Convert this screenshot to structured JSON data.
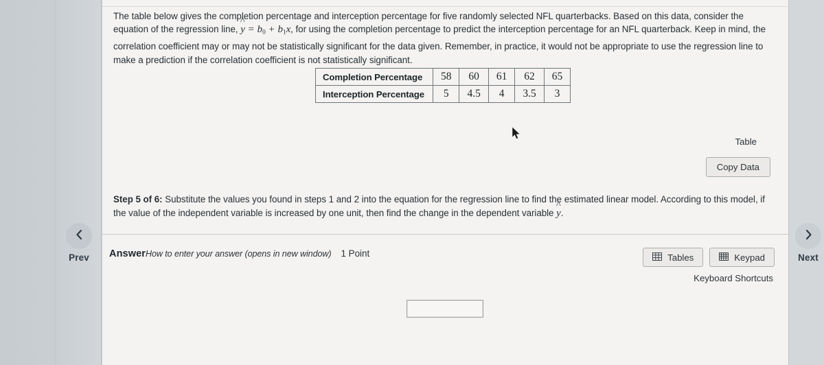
{
  "problem": {
    "text_part1": "The table below gives the completion percentage and interception percentage for five randomly selected NFL quarterbacks. Based on this data, consider the equation of the regression line, ",
    "equation": "ŷ = b₀ + b₁x",
    "text_part2": ", for using the completion percentage to predict the interception percentage for an NFL quarterback. Keep in mind, the correlation coefficient may or may not be statistically significant for the data given. Remember, in practice, it would not be appropriate to use the regression line to make a prediction if the correlation coefficient is not statistically significant."
  },
  "table": {
    "caption": "Table",
    "copy_button_label": "Copy Data",
    "rows": [
      {
        "header": "Completion Percentage",
        "values": [
          "58",
          "60",
          "61",
          "62",
          "65"
        ]
      },
      {
        "header": "Interception Percentage",
        "values": [
          "5",
          "4.5",
          "4",
          "3.5",
          "3"
        ]
      }
    ]
  },
  "step": {
    "label": "Step 5 of 6:",
    "text_part1": " Substitute the values you found in steps 1 and 2 into the equation for the regression line to find the estimated linear model. According to this model, if the value of the independent variable is increased by one unit, then find the change in the dependent variable ",
    "variable": "ŷ",
    "text_part2": "."
  },
  "answer": {
    "label": "Answer",
    "help_link": "How to enter your answer (opens in new window)",
    "points": "1 Point",
    "input_value": "",
    "input_placeholder": ""
  },
  "tools": {
    "tables_label": "Tables",
    "keypad_label": "Keypad",
    "keyboard_shortcuts_label": "Keyboard Shortcuts"
  },
  "navigation": {
    "prev_label": "Prev",
    "next_label": "Next",
    "prev_icon": "chevron-left-icon",
    "next_icon": "chevron-right-icon"
  },
  "colors": {
    "page_background": "#cad0d3",
    "content_background": "#f4f3f1",
    "text": "#283036",
    "button_border": "#a9aeb1",
    "nav_circle": "#c3c9ce"
  }
}
